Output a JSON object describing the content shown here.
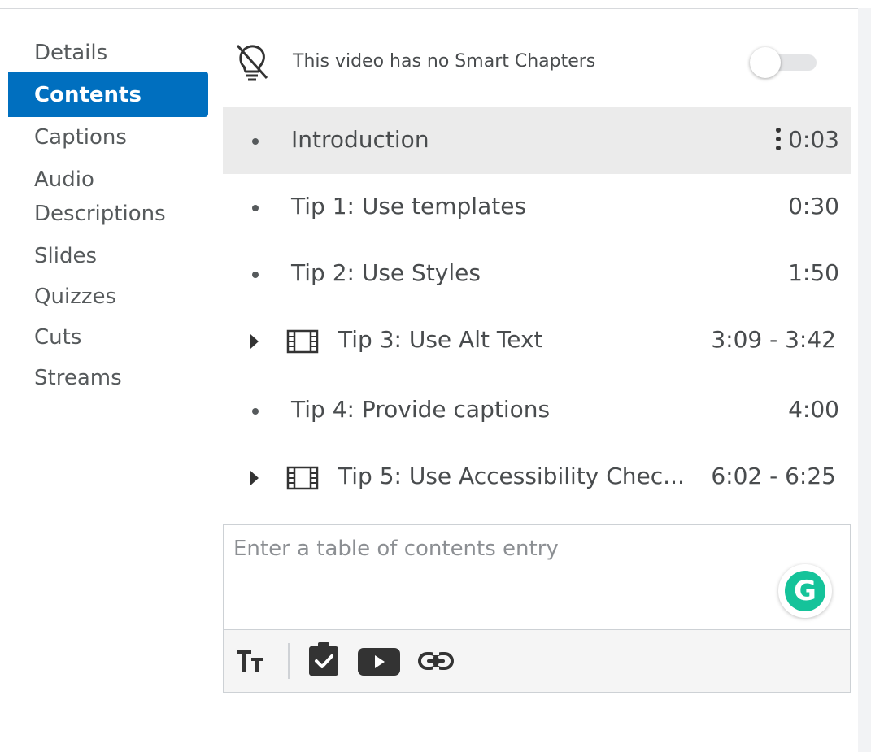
{
  "sidebar": {
    "items": [
      {
        "label": "Details"
      },
      {
        "label": "Contents"
      },
      {
        "label": "Captions"
      },
      {
        "label": "Audio Descriptions"
      },
      {
        "label": "Slides"
      },
      {
        "label": "Quizzes"
      },
      {
        "label": "Cuts"
      },
      {
        "label": "Streams"
      }
    ],
    "active": "Contents"
  },
  "smart_chapters": {
    "text": "This video has no Smart Chapters",
    "toggle_on": false
  },
  "chapters": [
    {
      "title": "Introduction",
      "time": "0:03",
      "type": "point",
      "selected": true
    },
    {
      "title": "Tip 1: Use templates",
      "time": "0:30",
      "type": "point"
    },
    {
      "title": "Tip 2: Use Styles",
      "time": "1:50",
      "type": "point"
    },
    {
      "title": "Tip 3: Use Alt Text",
      "time": "3:09 - 3:42",
      "type": "range"
    },
    {
      "title": "Tip 4: Provide captions",
      "time": "4:00",
      "type": "point"
    },
    {
      "title": "Tip 5: Use Accessibility Chec...",
      "time": "6:02 - 6:25",
      "type": "range"
    }
  ],
  "editor": {
    "placeholder": "Enter a table of contents entry",
    "grammarly_letter": "G"
  },
  "toolbar": {
    "icons": [
      "text-style-icon",
      "quiz-icon",
      "video-icon",
      "link-icon"
    ]
  },
  "colors": {
    "accent": "#006fbf",
    "selected_row": "#ebebeb",
    "grammarly": "#15c39a"
  }
}
